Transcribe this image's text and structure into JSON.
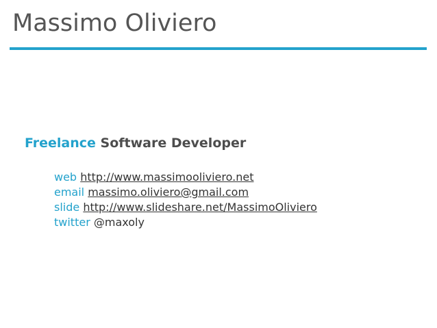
{
  "title": "Massimo Oliviero",
  "role": {
    "highlight": "Freelance",
    "rest": "Software Developer"
  },
  "contacts": [
    {
      "label": "web",
      "value": "http://www.massimooliviero.net",
      "link": true
    },
    {
      "label": "email",
      "value": "massimo.oliviero@gmail.com",
      "link": true
    },
    {
      "label": "slide",
      "value": "http://www.slideshare.net/MassimoOliviero",
      "link": true
    },
    {
      "label": "twitter",
      "value": "@maxoly",
      "link": false
    }
  ],
  "colors": {
    "accent": "#23a2cc",
    "title": "#555555",
    "text": "#333333"
  }
}
